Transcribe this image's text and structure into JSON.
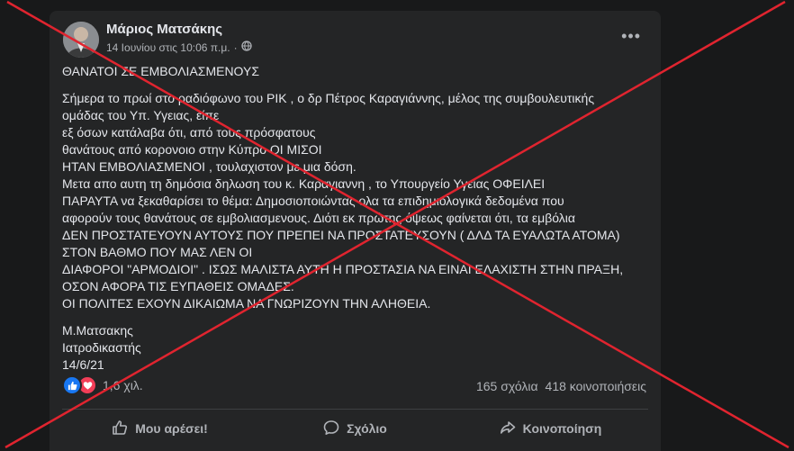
{
  "post": {
    "author": "Μάριος Ματσάκης",
    "timestamp": "14 Ιουνίου στις 10:06 π.μ.",
    "audience_icon": "globe-icon",
    "lines": [
      "ΘΑΝΑΤΟΙ ΣΕ ΕΜΒΟΛΙΑΣΜΕΝΟΥΣ",
      "",
      "Σήμερα το πρωί στο ραδιόφωνο του ΡΙΚ , ο δρ Πέτρος Καραγιάννης, μέλος της συμβουλευτικής",
      "ομάδας του Υπ. Υγειας, είπε",
      "εξ όσων κατάλαβα ότι, από τους πρόσφατους",
      "θανάτους από κορονοιο στην Κύπρο ΟΙ ΜΙΣΟΙ",
      "ΗΤΑΝ ΕΜΒΟΛΙΑΣΜΕΝΟΙ , τουλαχιστον με μια δόση.",
      "Μετα απο αυτη τη δημόσια  δηλωση του κ. Καραγιαννη  , το Υπουργείο Υγείας ΟΦΕΙΛΕΙ",
      "ΠΑΡΑΥΤΑ να ξεκαθαρίσει το θέμα: Δημοσιοποιώντας ολα τα επιδημιολογικά δεδομένα που",
      "αφορούν τους θανάτους σε εμβολιασμενους.  Διότι εκ πρώτης όψεως φαίνεται ότι, τα εμβόλια",
      "ΔΕΝ ΠΡΟΣΤΑΤΕΥΟΥΝ ΑΥΤΟΥΣ ΠΟΥ ΠΡΕΠΕΙ ΝΑ ΠΡΟΣΤΑΤΕΥΣΟΥΝ ( ΔΛΔ ΤΑ ΕΥΑΛΩΤΑ ΑΤΟΜΑ)",
      "ΣΤΟΝ ΒΑΘΜΟ ΠΟΥ ΜΑΣ ΛΕΝ ΟΙ",
      "ΔΙΑΦΟΡΟΙ \"ΑΡΜΟΔΙΟΙ\" .   ΙΣΩΣ ΜΑΛΙΣΤΑ ΑΥΤΗ Η ΠΡΟΣΤΑΣΙΑ ΝΑ ΕΙΝΑΙ ΕΛΑΧΙΣΤΗ ΣΤΗΝ ΠΡΑΞΗ,",
      "ΟΣΟΝ ΑΦΟΡΑ ΤΙΣ ΕΥΠΑΘΕΙΣ ΟΜΑΔΕΣ.",
      "ΟΙ ΠΟΛΙΤΕΣ ΕΧΟΥΝ ΔΙΚΑΙΩΜΑ ΝΑ ΓΝΩΡΙΖΟΥΝ ΤΗΝ ΑΛΗΘΕΙΑ.",
      "",
      "Μ.Ματσακης",
      "Ιατροδικαστής",
      "14/6/21"
    ]
  },
  "stats": {
    "reactions": "1,6 χιλ.",
    "comments": "165 σχόλια",
    "shares": "418 κοινοποιήσεις"
  },
  "actions": {
    "like": "Μου αρέσει!",
    "comment": "Σχόλιο",
    "share": "Κοινοποίηση"
  },
  "overlay": {
    "cross_color": "#e0242f"
  },
  "colors": {
    "background": "#18191a",
    "card": "#242526",
    "primary_text": "#e4e6eb",
    "secondary_text": "#b0b3b8",
    "like_blue": "#1877f2",
    "love_red": "#f33e58"
  }
}
